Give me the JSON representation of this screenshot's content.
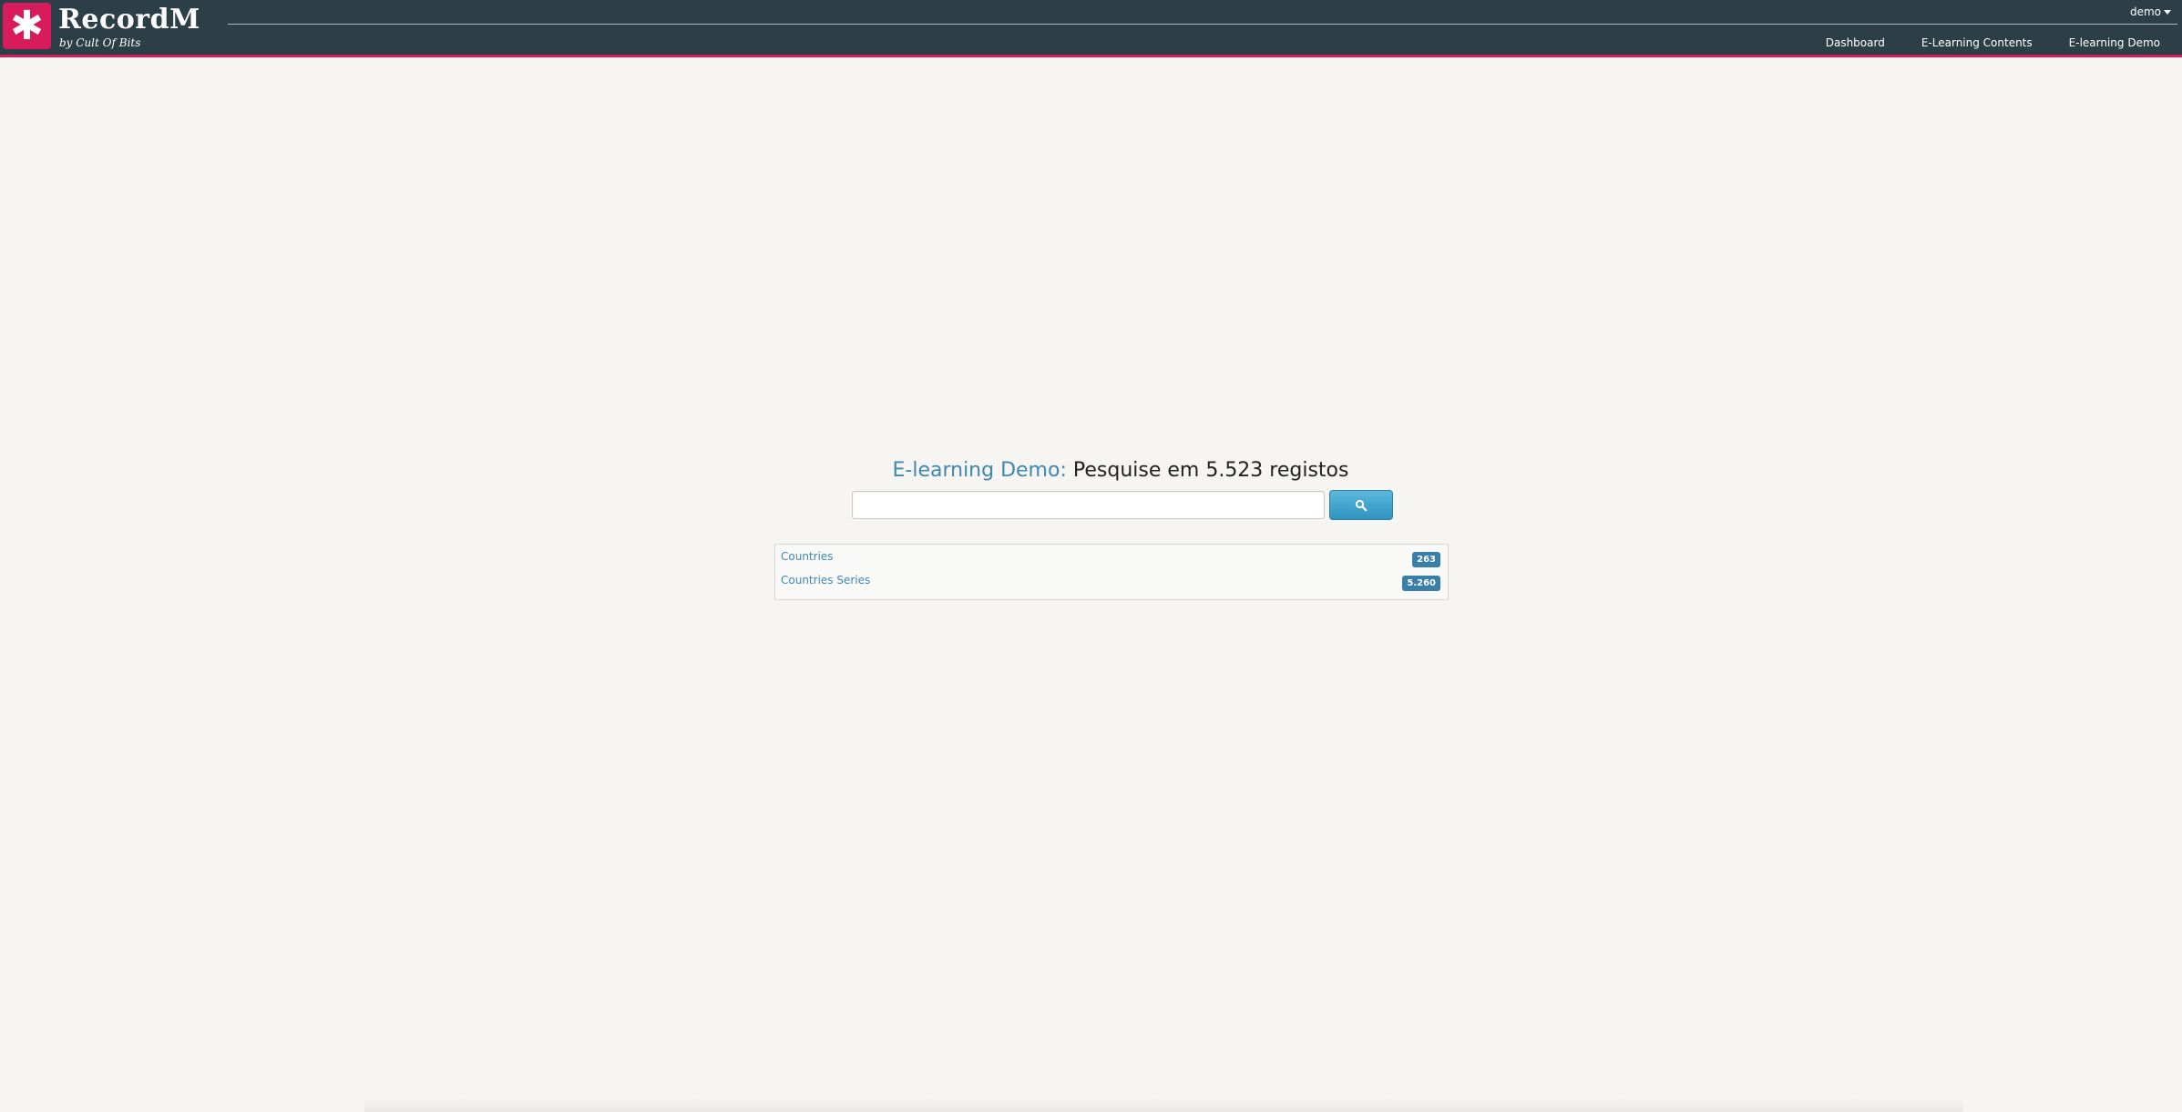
{
  "header": {
    "brand": "RecordM",
    "brand_sub": "by Cult Of Bits",
    "logo_icon": "asterisk-icon",
    "user": "demo",
    "nav": [
      {
        "label": "Dashboard"
      },
      {
        "label": "E-Learning Contents"
      },
      {
        "label": "E-learning Demo"
      }
    ],
    "colors": {
      "bar": "#2c3e46",
      "accent": "#d81b5b"
    }
  },
  "search": {
    "app_name": "E-learning Demo:",
    "prompt": "Pesquise em 5.523 registos",
    "value": "",
    "button_icon": "search-icon"
  },
  "results": [
    {
      "label": "Countries",
      "count": "263"
    },
    {
      "label": "Countries Series",
      "count": "5.260"
    }
  ],
  "colors": {
    "link": "#3f88b5",
    "badge": "#3a7fa9",
    "button": "#3aa3cf",
    "background": "#f6f5f1"
  }
}
